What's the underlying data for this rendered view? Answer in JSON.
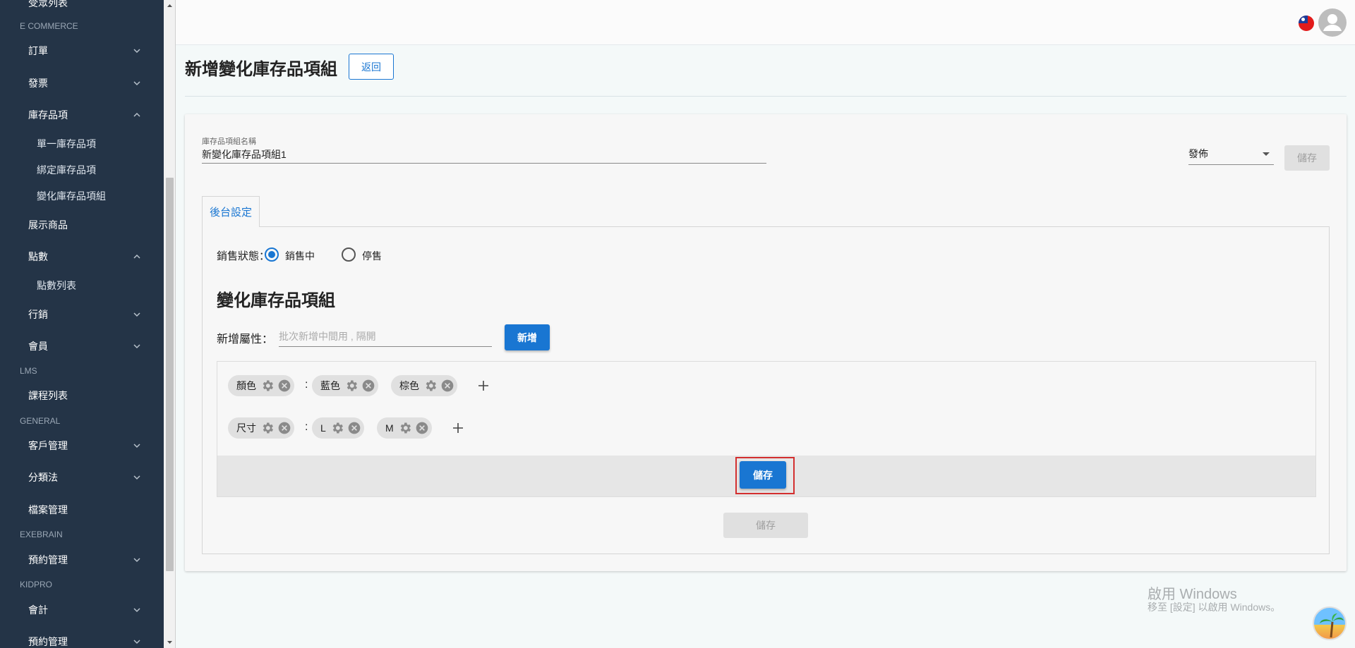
{
  "sidebar": {
    "partial_top": "受眾列表",
    "sections": {
      "ecommerce": "E COMMERCE",
      "lms": "LMS",
      "general": "GENERAL",
      "exebrain": "EXEBRAIN",
      "kidpro": "KIDPRO"
    },
    "items": {
      "orders": "訂單",
      "invoice": "發票",
      "inventory": "庫存品項",
      "single": "單一庫存品項",
      "bundle": "綁定庫存品項",
      "variant": "變化庫存品項組",
      "showcase": "展示商品",
      "points": "點數",
      "points_list": "點數列表",
      "marketing": "行銷",
      "members": "會員",
      "courses": "課程列表",
      "customers": "客戶管理",
      "taxonomy": "分類法",
      "files": "檔案管理",
      "booking": "預約管理",
      "accounting": "會計",
      "booking2": "預約管理"
    }
  },
  "header": {
    "title": "新增變化庫存品項組",
    "back_label": "返回"
  },
  "form": {
    "name_label": "庫存品項組名稱",
    "name_value": "新變化庫存品項組1",
    "publish_value": "發佈",
    "top_save_label": "儲存",
    "tab_label": "後台設定",
    "status_label": "銷售狀態：",
    "status_on": "銷售中",
    "status_off": "停售",
    "section_title": "變化庫存品項組",
    "attr_label": "新增屬性：",
    "attr_placeholder": "批次新增中間用 , 隔開",
    "add_label": "新增",
    "inner_save_label": "儲存",
    "bottom_save_label": "儲存"
  },
  "attributes": {
    "row1": {
      "name": "顏色",
      "values": [
        "藍色",
        "棕色"
      ]
    },
    "row2": {
      "name": "尺寸",
      "values": [
        "L",
        "M"
      ]
    }
  },
  "colon": ":",
  "watermark": {
    "line1": "啟用 Windows",
    "line2": "移至 [設定] 以啟用 Windows。"
  },
  "colors": {
    "primary": "#1976d2",
    "sidebar": "#243447",
    "highlight": "#d32f2f"
  }
}
